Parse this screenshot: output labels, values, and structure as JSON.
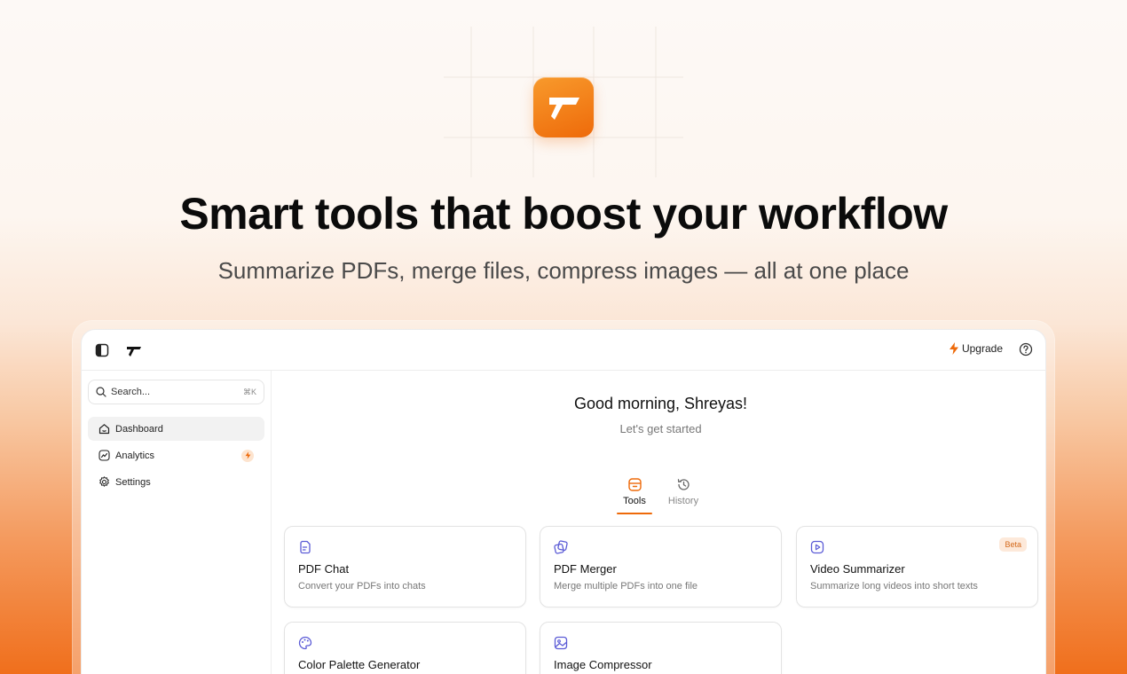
{
  "hero": {
    "title": "Smart tools that boost your workflow",
    "subtitle": "Summarize PDFs, merge files, compress images — all at one place"
  },
  "topbar": {
    "upgrade_label": "Upgrade"
  },
  "sidebar": {
    "search_placeholder": "Search...",
    "search_shortcut": "⌘K",
    "items": [
      {
        "label": "Dashboard",
        "icon": "home-icon",
        "active": true
      },
      {
        "label": "Analytics",
        "icon": "chart-icon",
        "active": false
      },
      {
        "label": "Settings",
        "icon": "gear-icon",
        "active": false
      }
    ]
  },
  "main": {
    "greeting": "Good morning, Shreyas!",
    "subtext": "Let's get started",
    "tabs": [
      {
        "label": "Tools",
        "icon": "toolbox-icon",
        "active": true
      },
      {
        "label": "History",
        "icon": "history-icon",
        "active": false
      }
    ],
    "tools": [
      {
        "title": "PDF Chat",
        "description": "Convert your PDFs into chats",
        "icon": "document-icon"
      },
      {
        "title": "PDF Merger",
        "description": "Merge multiple PDFs into one file",
        "icon": "merge-icon"
      },
      {
        "title": "Video Summarizer",
        "description": "Summarize long videos into short texts",
        "icon": "video-icon",
        "badge": "Beta"
      },
      {
        "title": "Color Palette Generator",
        "description": "",
        "icon": "palette-icon"
      },
      {
        "title": "Image Compressor",
        "description": "",
        "icon": "image-icon"
      }
    ]
  },
  "colors": {
    "brand_orange": "#ee6a0a",
    "tool_icon": "#5b5bd6"
  }
}
